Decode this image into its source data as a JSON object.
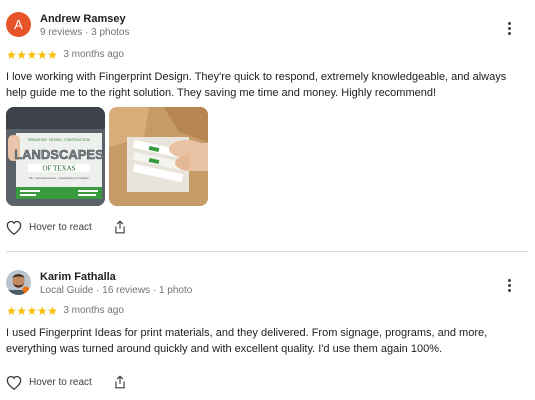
{
  "reviews": [
    {
      "avatar_letter": "A",
      "avatar_color": "#e8542a",
      "name": "Andrew Ramsey",
      "meta": "9 reviews · 3 photos",
      "stars": 5,
      "time": "3 months ago",
      "text": "I love working with Fingerprint Design. They're quick to respond, extremely knowledgeable, and always help guide me to the right solution. They saving me time and money. Highly recommend!",
      "photos": [
        {
          "caption_top": "IRRIGATION · DESIGN · CONSTRUCTION",
          "brand": "LANDSCAPES",
          "sub": "OF TEXAS",
          "tagline": "40+ Years Experience · Landscaping & Irrigation"
        },
        {
          "caption": ""
        }
      ],
      "react_label": "Hover to react"
    },
    {
      "name": "Karim Fathalla",
      "meta": "Local Guide · 16 reviews · 1 photo",
      "stars": 5,
      "time": "3 months ago",
      "text": "I used Fingerprint Ideas for print materials, and they delivered. From signage, programs, and more, everything was turned around quickly and with excellent quality. I'd use them again 100%.",
      "react_label": "Hover to react"
    }
  ],
  "icons": {
    "star": "star-icon",
    "more": "more-vert-icon",
    "heart": "heart-outline-icon",
    "share": "share-icon"
  },
  "colors": {
    "star": "#fbbc04",
    "text": "#202124",
    "secondary": "#70757a"
  }
}
